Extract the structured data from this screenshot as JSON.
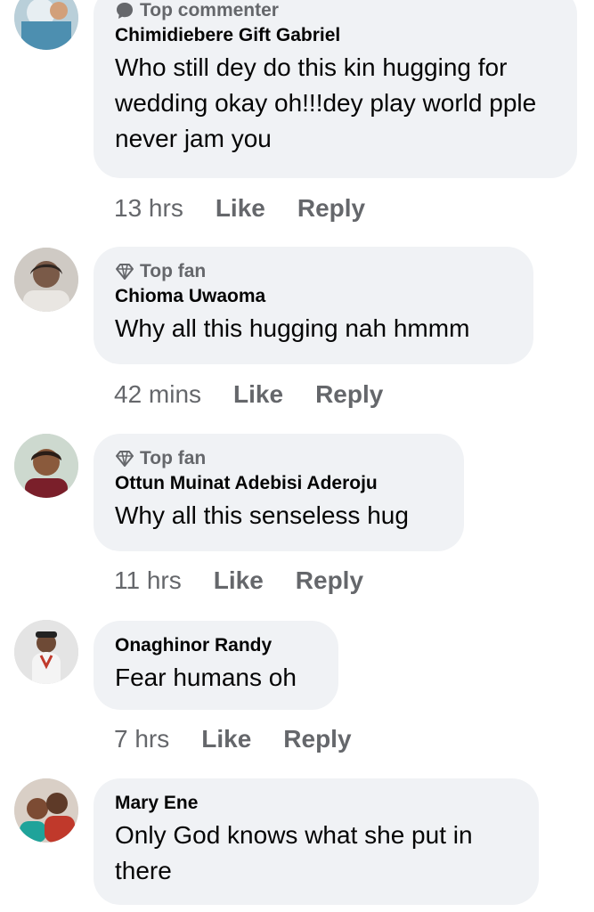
{
  "comments": [
    {
      "badge": "Top commenter",
      "badge_icon": "chat-bubble-icon",
      "name": "Chimidiebere Gift Gabriel",
      "text": "Who still dey do this kin hugging for wedding okay oh!!!dey play world pple never jam you",
      "time": "13 hrs",
      "like": "Like",
      "reply": "Reply"
    },
    {
      "badge": "Top fan",
      "badge_icon": "diamond-icon",
      "name": "Chioma Uwaoma",
      "text": "Why all this hugging nah hmmm",
      "time": "42 mins",
      "like": "Like",
      "reply": "Reply"
    },
    {
      "badge": "Top fan",
      "badge_icon": "diamond-icon",
      "name": "Ottun Muinat Adebisi Aderoju",
      "text": "Why all this senseless hug",
      "time": "11 hrs",
      "like": "Like",
      "reply": "Reply"
    },
    {
      "badge": "",
      "name": "Onaghinor Randy",
      "text": "Fear humans oh",
      "time": "7 hrs",
      "like": "Like",
      "reply": "Reply"
    },
    {
      "badge": "",
      "name": "Mary Ene",
      "text": "Only God knows what  she put in there"
    }
  ],
  "colors": {
    "bubble": "#f0f2f5",
    "secondary_text": "#65676b",
    "primary_text": "#050505"
  }
}
